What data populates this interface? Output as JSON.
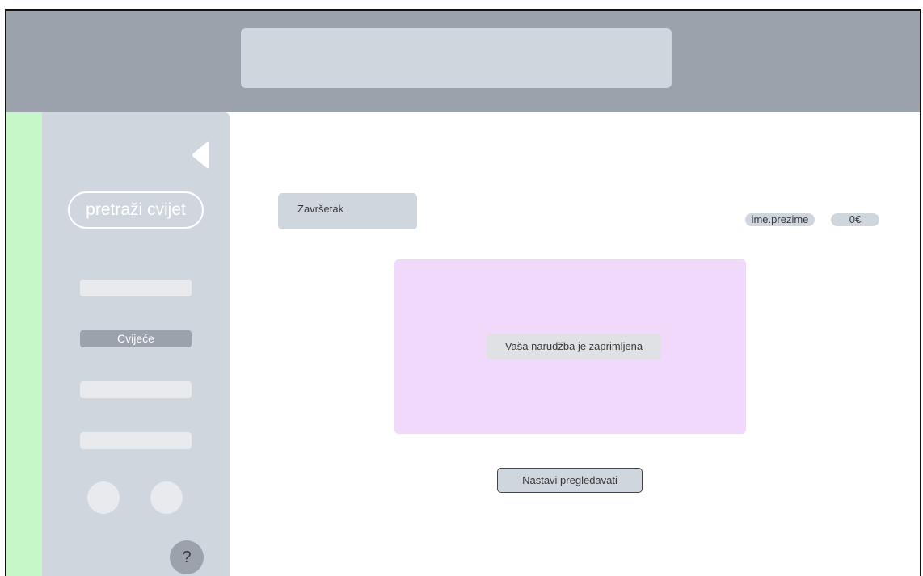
{
  "header": {
    "search_placeholder": ""
  },
  "sidebar": {
    "collapse_icon": "triangle-left-icon",
    "search_label": "pretraži cvijet",
    "items": [
      {
        "label": ""
      },
      {
        "label": "Cvijeće",
        "active": true
      },
      {
        "label": ""
      },
      {
        "label": ""
      }
    ],
    "help_label": "?"
  },
  "main": {
    "step_label": "Završetak",
    "user_name": "ime.prezime",
    "cart_total": "0€",
    "order_message": "Vaša narudžba je zaprimljena",
    "continue_label": "Nastavi pregledavati"
  },
  "colors": {
    "header": "#9ca2ac",
    "sidebar": "#d0d6de",
    "green_strip": "#c5f7c9",
    "order_panel": "#f0d9fb"
  }
}
